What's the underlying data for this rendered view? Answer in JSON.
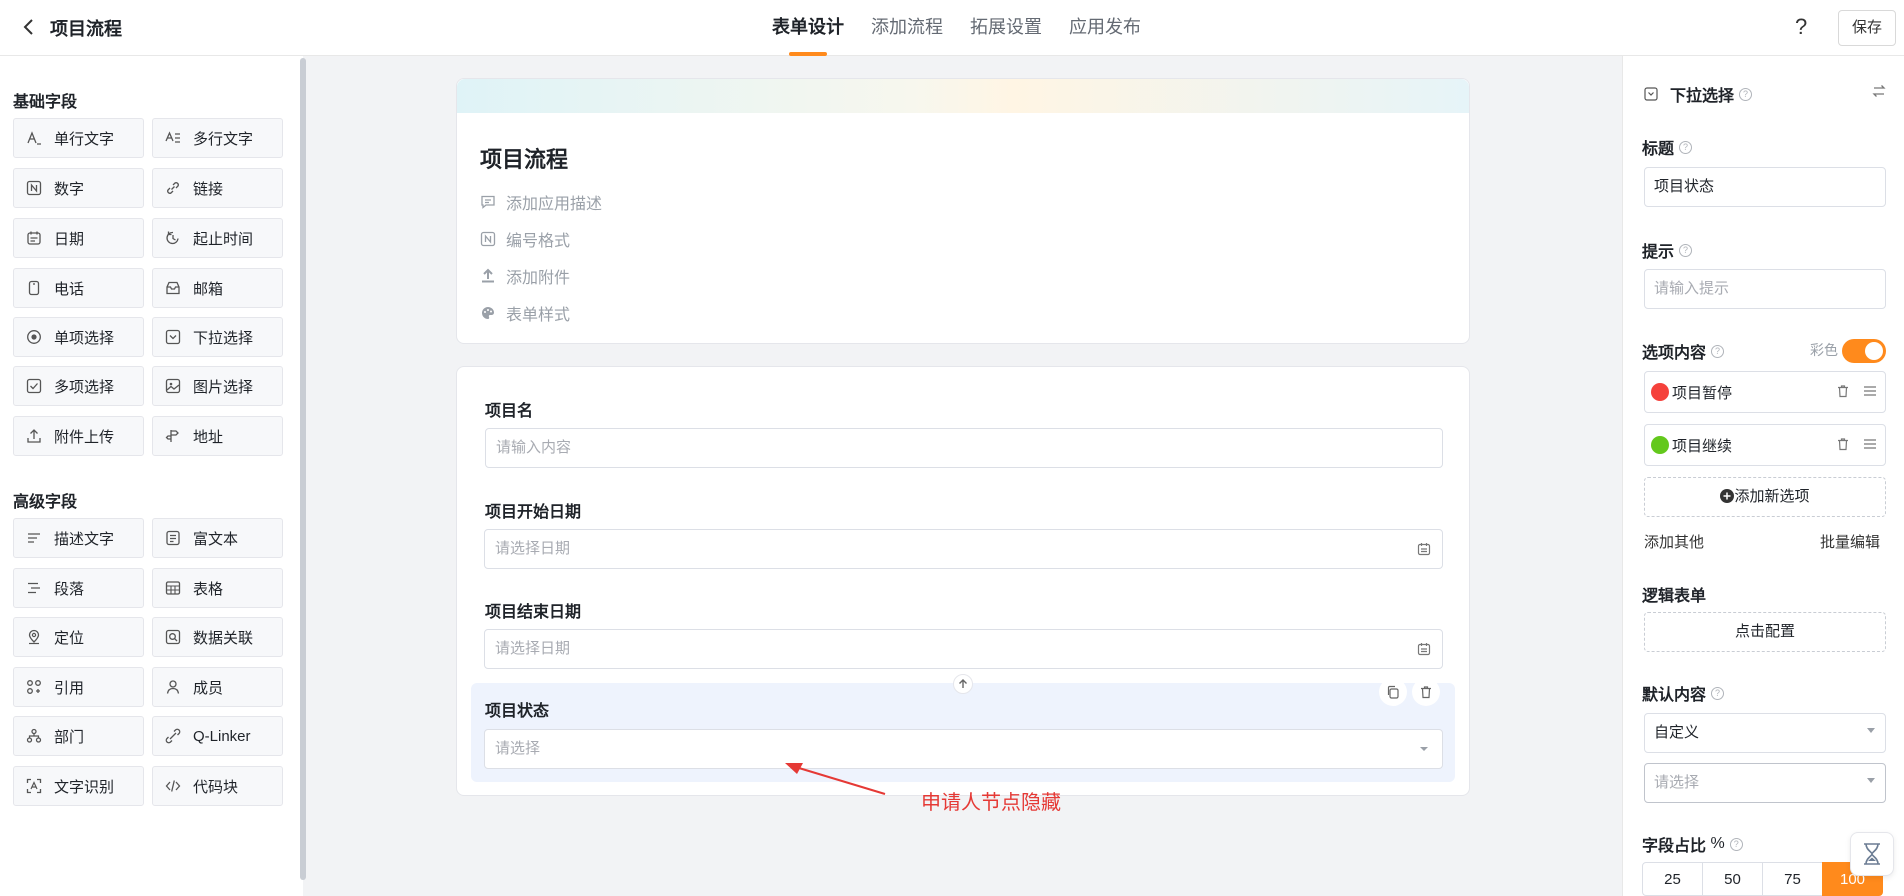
{
  "header": {
    "title": "项目流程",
    "tabs": [
      "表单设计",
      "添加流程",
      "拓展设置",
      "应用发布"
    ],
    "active_tab": "表单设计",
    "help_label": "?",
    "save_label": "保存"
  },
  "palette": {
    "basic_title": "基础字段",
    "basic": [
      "单行文字",
      "多行文字",
      "数字",
      "链接",
      "日期",
      "起止时间",
      "电话",
      "邮箱",
      "单项选择",
      "下拉选择",
      "多项选择",
      "图片选择",
      "附件上传",
      "地址"
    ],
    "advanced_title": "高级字段",
    "advanced": [
      "描述文字",
      "富文本",
      "段落",
      "表格",
      "定位",
      "数据关联",
      "引用",
      "成员",
      "部门",
      "Q-Linker",
      "文字识别",
      "代码块"
    ]
  },
  "form": {
    "title": "项目流程",
    "meta": [
      "添加应用描述",
      "编号格式",
      "添加附件",
      "表单样式"
    ],
    "fields": [
      {
        "label": "项目名",
        "placeholder": "请输入内容"
      },
      {
        "label": "项目开始日期",
        "placeholder": "请选择日期"
      },
      {
        "label": "项目结束日期",
        "placeholder": "请选择日期"
      },
      {
        "label": "项目状态",
        "placeholder": "请选择"
      }
    ]
  },
  "annotation": "申请人节点隐藏",
  "props": {
    "type_title": "下拉选择",
    "title_label": "标题",
    "title_value": "项目状态",
    "hint_label": "提示",
    "hint_placeholder": "请输入提示",
    "options_label": "选项内容",
    "color_toggle_label": "彩色",
    "color_toggle_on": true,
    "options": [
      {
        "label": "项目暂停",
        "color": "#f5413b"
      },
      {
        "label": "项目继续",
        "color": "#63c81c"
      }
    ],
    "add_option": "添加新选项",
    "add_other": "添加其他",
    "batch_edit": "批量编辑",
    "logic_label": "逻辑表单",
    "logic_button": "点击配置",
    "default_label": "默认内容",
    "default_mode": "自定义",
    "default_placeholder": "请选择",
    "width_label": "字段占比",
    "width_unit": "%",
    "width_options": [
      "25",
      "50",
      "75",
      "100"
    ],
    "width_selected": "100"
  },
  "colors": {
    "accent": "#ff8a1c",
    "annotation": "#e53935"
  }
}
